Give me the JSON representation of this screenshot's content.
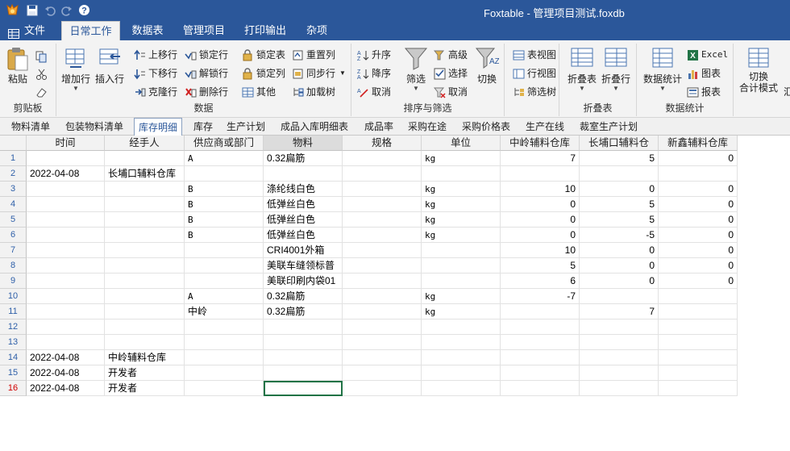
{
  "window": {
    "title": "Foxtable - 管理项目测试.foxdb"
  },
  "colors": {
    "title_bar": "#2b579a",
    "row_number": "#2e5fa8",
    "current_row_number": "#d00000",
    "selection_border": "#217346"
  },
  "quick_access": [
    "app-logo-icon",
    "save-icon",
    "undo-icon",
    "redo-icon",
    "help-icon"
  ],
  "menu": {
    "file": "文件",
    "tabs": [
      "日常工作",
      "数据表",
      "管理项目",
      "打印输出",
      "杂项"
    ],
    "active": "日常工作"
  },
  "ribbon": {
    "clipboard": {
      "label": "剪贴板",
      "paste": "粘贴"
    },
    "data": {
      "label": "数据",
      "add_row": "增加行",
      "insert_row": "插入行",
      "move_up": "上移行",
      "move_down": "下移行",
      "clone_row": "克隆行",
      "lock_row": "锁定行",
      "unlock_row": "解锁行",
      "delete_row": "删除行",
      "lock_table": "锁定表",
      "lock_column": "锁定列",
      "other": "其他",
      "reset_column": "重置列",
      "sync_row": "同步行",
      "load_tree": "加载树"
    },
    "sort_filter": {
      "label": "排序与筛选",
      "asc": "升序",
      "desc": "降序",
      "cancel_sort": "取消",
      "filter": "筛选",
      "advanced": "高级",
      "select": "选择",
      "cancel_filter": "取消",
      "toggle": "切换"
    },
    "views": {
      "table_view": "表视图",
      "row_view": "行视图",
      "filter_tree": "筛选树"
    },
    "fold": {
      "label": "折叠表",
      "fold_table": "折叠表",
      "fold_row": "折叠行"
    },
    "stats": {
      "label": "数据统计",
      "data_stats": "数据统计",
      "excel": "Excel",
      "chart": "图表",
      "report": "报表",
      "toggle_total": "切换",
      "total_mode": "合计模式",
      "more": "汇"
    }
  },
  "sheet_tabs": [
    "物料清单",
    "包装物料清单",
    "库存明细",
    "库存",
    "生产计划",
    "成品入库明细表",
    "成品率",
    "采购在途",
    "采购价格表",
    "生产在线",
    "裁室生产计划"
  ],
  "active_sheet": "库存明细",
  "grid": {
    "columns": [
      "时间",
      "经手人",
      "供应商或部门",
      "物料",
      "规格",
      "单位",
      "中岭辅料仓库",
      "长埔口辅料仓",
      "新鑫辅料仓库"
    ],
    "selected_column": "物料",
    "current_row": "16",
    "rows": [
      {
        "n": "1",
        "c": [
          "",
          "",
          "A",
          "0.32扁筋",
          "",
          "kg",
          "7",
          "5",
          "0"
        ]
      },
      {
        "n": "2",
        "c": [
          "2022-04-08",
          "长埔口辅料仓库",
          "",
          "",
          "",
          "",
          "",
          "",
          ""
        ]
      },
      {
        "n": "3",
        "c": [
          "",
          "",
          "B",
          "涤纶线白色",
          "",
          "kg",
          "10",
          "0",
          "0"
        ]
      },
      {
        "n": "4",
        "c": [
          "",
          "",
          "B",
          "低弹丝白色",
          "",
          "kg",
          "0",
          "5",
          "0"
        ]
      },
      {
        "n": "5",
        "c": [
          "",
          "",
          "B",
          "低弹丝白色",
          "",
          "kg",
          "0",
          "5",
          "0"
        ]
      },
      {
        "n": "6",
        "c": [
          "",
          "",
          "B",
          "低弹丝白色",
          "",
          "kg",
          "0",
          "-5",
          "0"
        ]
      },
      {
        "n": "7",
        "c": [
          "",
          "",
          "",
          "CRI4001外箱",
          "",
          "",
          "10",
          "0",
          "0"
        ]
      },
      {
        "n": "8",
        "c": [
          "",
          "",
          "",
          "美联车缝领标普",
          "",
          "",
          "5",
          "0",
          "0"
        ]
      },
      {
        "n": "9",
        "c": [
          "",
          "",
          "",
          "美联印刷内袋01",
          "",
          "",
          "6",
          "0",
          "0"
        ]
      },
      {
        "n": "10",
        "c": [
          "",
          "",
          "A",
          "0.32扁筋",
          "",
          "kg",
          "-7",
          "",
          ""
        ]
      },
      {
        "n": "11",
        "c": [
          "",
          "",
          "中岭",
          "0.32扁筋",
          "",
          "kg",
          "",
          "7",
          ""
        ]
      },
      {
        "n": "12",
        "c": [
          "",
          "",
          "",
          "",
          "",
          "",
          "",
          "",
          ""
        ]
      },
      {
        "n": "13",
        "c": [
          "",
          "",
          "",
          "",
          "",
          "",
          "",
          "",
          ""
        ]
      },
      {
        "n": "14",
        "c": [
          "2022-04-08",
          "中岭辅料仓库",
          "",
          "",
          "",
          "",
          "",
          "",
          ""
        ]
      },
      {
        "n": "15",
        "c": [
          "2022-04-08",
          "开发者",
          "",
          "",
          "",
          "",
          "",
          "",
          ""
        ]
      },
      {
        "n": "16",
        "c": [
          "2022-04-08",
          "开发者",
          "",
          "",
          "",
          "",
          "",
          "",
          ""
        ]
      }
    ]
  }
}
